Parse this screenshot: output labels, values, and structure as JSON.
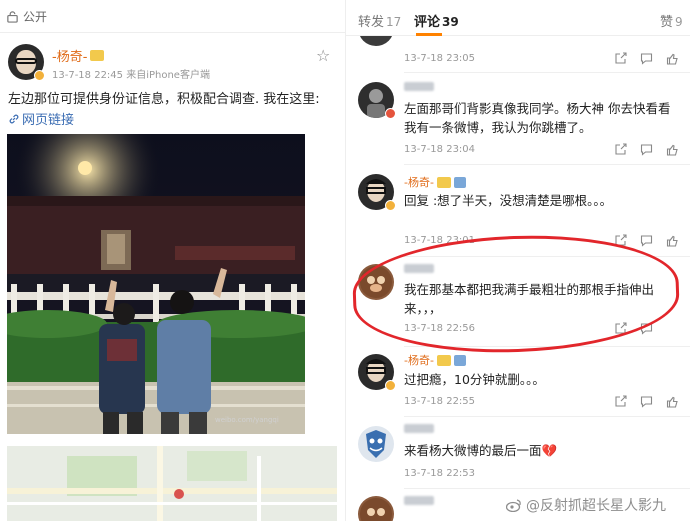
{
  "post": {
    "visibility": "公开",
    "author": "-杨奇-",
    "meta": "13-7-18 22:45  来自iPhone客户端",
    "text": "左边那位可提供身份证信息，积极配合调查. 我在这里:",
    "link": "网页链接",
    "photo_caption": "weibo.com/yangqi"
  },
  "tabs": [
    {
      "label": "转发",
      "count": "17"
    },
    {
      "label": "评论",
      "count": "39"
    },
    {
      "label": "赞",
      "count": "9"
    }
  ],
  "comments": [
    {
      "name": "",
      "text": "",
      "time": "13-7-18 23:05"
    },
    {
      "name": "",
      "text": "左面那哥们背影真像我同学。杨大神 你去快看看我有一条微博，我认为你跳槽了。",
      "time": "13-7-18 23:04"
    },
    {
      "name": "-杨奇-",
      "text": "回复            :想了半天，没想清楚是哪根。。。",
      "time": "13-7-18 23:01"
    },
    {
      "name": "",
      "text": "我在那基本都把我满手最粗壮的那根手指伸出来，，，",
      "time": "13-7-18 22:56"
    },
    {
      "name": "-杨奇-",
      "text": "过把瘾，10分钟就删。。。",
      "time": "13-7-18 22:55"
    },
    {
      "name": "",
      "text": "来看杨大微博的最后一面💔",
      "time": "13-7-18 22:53"
    },
    {
      "name": "",
      "text": "",
      "time": ""
    }
  ],
  "watermark": "@反射抓超长星人影九",
  "colors": {
    "accent": "#ff8200",
    "name": "#e06c1a",
    "link": "#3b6db3",
    "ring": "#e2262b"
  }
}
